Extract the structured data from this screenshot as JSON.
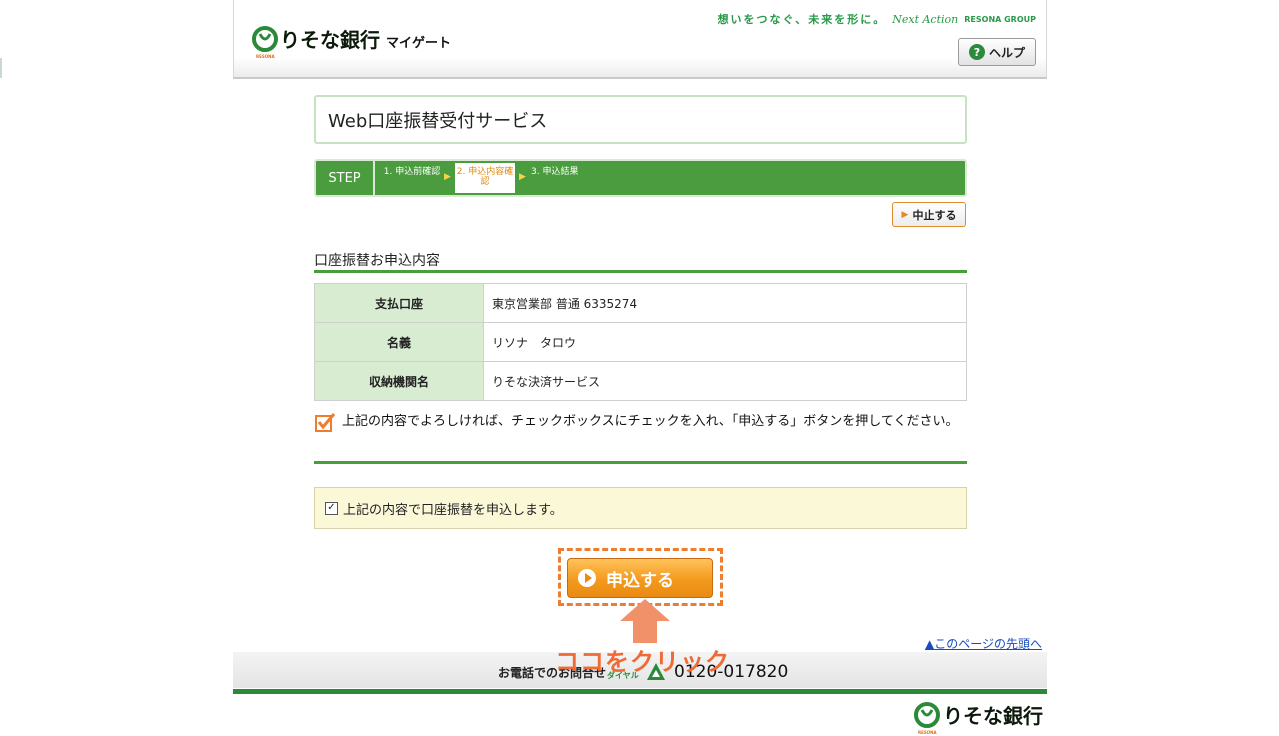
{
  "header": {
    "brand": "りそな銀行",
    "sub": "マイゲート",
    "resona_small": "RESONA",
    "tagline_jp": "想いをつなぐ、未来を形に。",
    "tagline_next": "Next Action",
    "tagline_group": "RESONA GROUP",
    "help_label": "ヘルプ"
  },
  "page": {
    "title": "Web口座振替受付サービス"
  },
  "steps": {
    "label": "STEP",
    "items": [
      {
        "label": "1. 申込前確認"
      },
      {
        "label": "2. 申込内容確認"
      },
      {
        "label": "3. 申込結果"
      }
    ]
  },
  "buttons": {
    "stop": "中止する",
    "submit": "申込する"
  },
  "section": {
    "title": "口座振替お申込内容",
    "rows": [
      {
        "label": "支払口座",
        "value": "東京営業部 普通 6335274"
      },
      {
        "label": "名義",
        "value": "リソナ　タロウ"
      },
      {
        "label": "収納機関名",
        "value": "りそな決済サービス"
      }
    ]
  },
  "notice": "上記の内容でよろしければ、チェックボックスにチェックを入れ、「申込する」ボタンを押してください。",
  "agree": {
    "label": "上記の内容で口座振替を申込します。",
    "checked": true
  },
  "annotation": {
    "click_label": "ココをクリック",
    "color": "#ef7d2f"
  },
  "footer": {
    "page_top": "▲このページの先頭へ",
    "contact": "お電話でのお問合せ",
    "dial": "ダイヤル",
    "number": "0120-017820",
    "brand": "りそな銀行",
    "resona_small": "RESONA"
  },
  "colors": {
    "green": "#4a9c3e",
    "orange": "#f39a1e",
    "light_green": "#d8ecd2",
    "agree_bg": "#fbf8d8"
  }
}
